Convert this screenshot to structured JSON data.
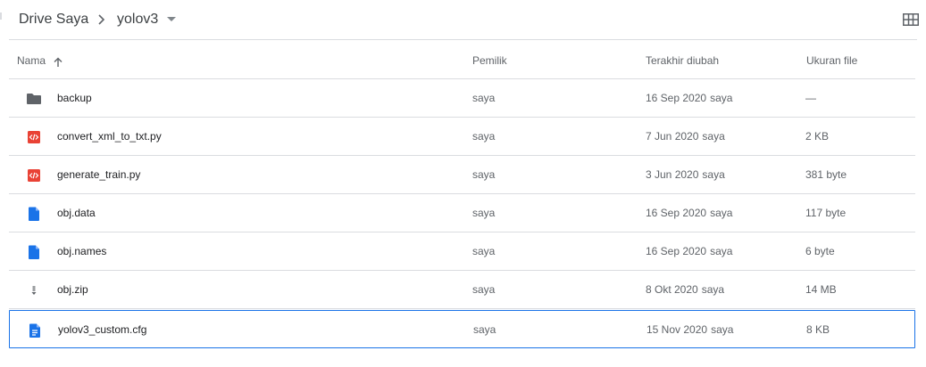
{
  "breadcrumb": {
    "root": "Drive Saya",
    "current": "yolov3"
  },
  "columns": {
    "name": "Nama",
    "owner": "Pemilik",
    "modified": "Terakhir diubah",
    "size": "Ukuran file"
  },
  "colors": {
    "folder": "#5f6368",
    "code": "#e94235",
    "doc": "#1a73e8",
    "selection": "#1a73e8"
  },
  "files": [
    {
      "name": "backup",
      "icon": "folder-icon",
      "owner": "saya",
      "date": "16 Sep 2020",
      "by": "saya",
      "size": "—"
    },
    {
      "name": "convert_xml_to_txt.py",
      "icon": "code-file-icon",
      "owner": "saya",
      "date": "7 Jun 2020",
      "by": "saya",
      "size": "2 KB"
    },
    {
      "name": "generate_train.py",
      "icon": "code-file-icon",
      "owner": "saya",
      "date": "3 Jun 2020",
      "by": "saya",
      "size": "381 byte"
    },
    {
      "name": "obj.data",
      "icon": "blank-file-icon",
      "owner": "saya",
      "date": "16 Sep 2020",
      "by": "saya",
      "size": "117 byte"
    },
    {
      "name": "obj.names",
      "icon": "blank-file-icon",
      "owner": "saya",
      "date": "16 Sep 2020",
      "by": "saya",
      "size": "6 byte"
    },
    {
      "name": "obj.zip",
      "icon": "archive-icon",
      "owner": "saya",
      "date": "8 Okt 2020",
      "by": "saya",
      "size": "14 MB"
    },
    {
      "name": "yolov3_custom.cfg",
      "icon": "text-file-icon",
      "owner": "saya",
      "date": "15 Nov 2020",
      "by": "saya",
      "size": "8 KB",
      "selected": true
    }
  ]
}
